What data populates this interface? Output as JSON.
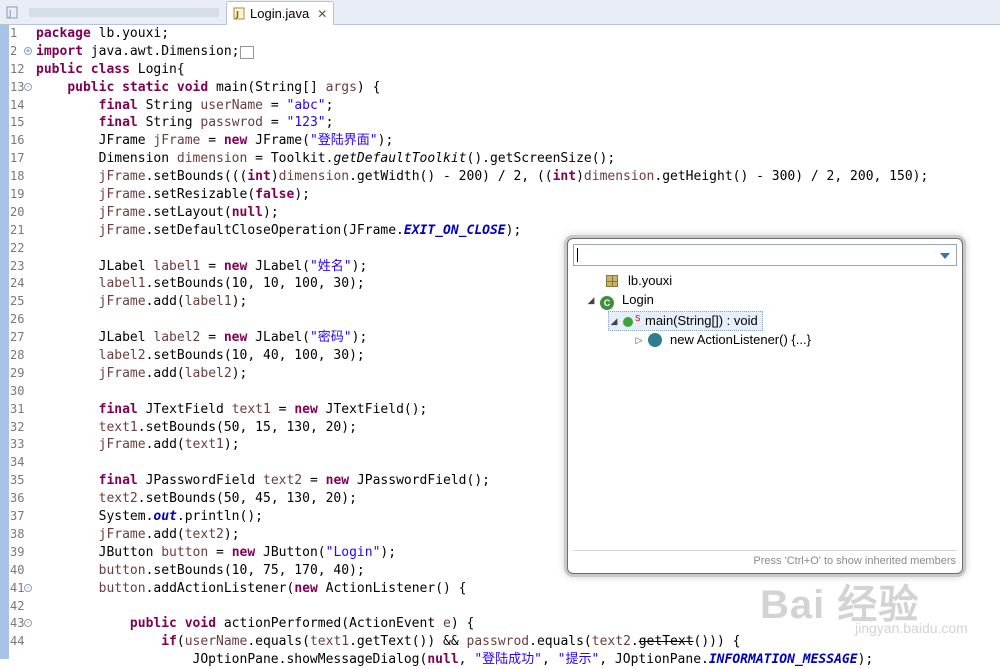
{
  "tabs": [
    {
      "label": "",
      "active": false
    },
    {
      "label": "Login.java",
      "active": true,
      "close": "✕"
    }
  ],
  "code_lines": [
    {
      "n": "1",
      "html": "<span class='kw'>package</span> lb.youxi;"
    },
    {
      "n": "2",
      "fold": "+",
      "html": "<span class='kw'>import</span> java.awt.Dimension;<span style='border:1px solid #999;font-size:10px'>&nbsp;&nbsp;</span>"
    },
    {
      "n": "12",
      "html": "<span class='kw'>public class</span> Login{"
    },
    {
      "n": "13",
      "fold": "-",
      "html": "    <span class='kw'>public static void</span> main(String[] <span class='var'>args</span>) {"
    },
    {
      "n": "14",
      "html": "        <span class='kw'>final</span> String <span class='var'>userName</span> = <span class='str'>\"abc\"</span>;"
    },
    {
      "n": "15",
      "html": "        <span class='kw'>final</span> String <span class='var'>passwrod</span> = <span class='str'>\"123\"</span>;"
    },
    {
      "n": "16",
      "html": "        JFrame <span class='var'>jFrame</span> = <span class='kw'>new</span> JFrame(<span class='str'>\"登陆界面\"</span>);"
    },
    {
      "n": "17",
      "html": "        Dimension <span class='var'>dimension</span> = Toolkit.<span class='ital'>getDefaultToolkit</span>().getScreenSize();"
    },
    {
      "n": "18",
      "html": "        <span class='var'>jFrame</span>.setBounds(((<span class='kw'>int</span>)<span class='var'>dimension</span>.getWidth() - 200) / 2, ((<span class='kw'>int</span>)<span class='var'>dimension</span>.getHeight() - 300) / 2, 200, 150);"
    },
    {
      "n": "19",
      "html": "        <span class='var'>jFrame</span>.setResizable(<span class='kw'>false</span>);"
    },
    {
      "n": "20",
      "html": "        <span class='var'>jFrame</span>.setLayout(<span class='kw'>null</span>);"
    },
    {
      "n": "21",
      "html": "        <span class='var'>jFrame</span>.setDefaultCloseOperation(JFrame.<span class='fldi'>EXIT_ON_CLOSE</span>);"
    },
    {
      "n": "22",
      "html": ""
    },
    {
      "n": "23",
      "html": "        JLabel <span class='var'>label1</span> = <span class='kw'>new</span> JLabel(<span class='str'>\"姓名\"</span>);"
    },
    {
      "n": "24",
      "html": "        <span class='var'>label1</span>.setBounds(10, 10, 100, 30);"
    },
    {
      "n": "25",
      "html": "        <span class='var'>jFrame</span>.add(<span class='var'>label1</span>);"
    },
    {
      "n": "26",
      "html": ""
    },
    {
      "n": "27",
      "html": "        JLabel <span class='var'>label2</span> = <span class='kw'>new</span> JLabel(<span class='str'>\"密码\"</span>);"
    },
    {
      "n": "28",
      "html": "        <span class='var'>label2</span>.setBounds(10, 40, 100, 30);"
    },
    {
      "n": "29",
      "html": "        <span class='var'>jFrame</span>.add(<span class='var'>label2</span>);"
    },
    {
      "n": "30",
      "html": ""
    },
    {
      "n": "31",
      "html": "        <span class='kw'>final</span> JTextField <span class='var'>text1</span> = <span class='kw'>new</span> JTextField();"
    },
    {
      "n": "32",
      "html": "        <span class='var'>text1</span>.setBounds(50, 15, 130, 20);"
    },
    {
      "n": "33",
      "html": "        <span class='var'>jFrame</span>.add(<span class='var'>text1</span>);"
    },
    {
      "n": "34",
      "html": ""
    },
    {
      "n": "35",
      "html": "        <span class='kw'>final</span> JPasswordField <span class='var'>text2</span> = <span class='kw'>new</span> JPasswordField();"
    },
    {
      "n": "36",
      "html": "        <span class='var'>text2</span>.setBounds(50, 45, 130, 20);"
    },
    {
      "n": "37",
      "html": "        System.<span class='fldi'>out</span>.println();"
    },
    {
      "n": "38",
      "html": "        <span class='var'>jFrame</span>.add(<span class='var'>text2</span>);"
    },
    {
      "n": "39",
      "html": "        JButton <span class='var'>button</span> = <span class='kw'>new</span> JButton(<span class='str'>\"Login\"</span>);"
    },
    {
      "n": "40",
      "html": "        <span class='var'>button</span>.setBounds(10, 75, 170, 40);"
    },
    {
      "n": "41",
      "fold": "-",
      "html": "        <span class='var'>button</span>.addActionListener(<span class='kw'>new</span> ActionListener() {"
    },
    {
      "n": "42",
      "html": ""
    },
    {
      "n": "43",
      "fold": "-",
      "html": "            <span class='kw'>public void</span> actionPerformed(ActionEvent <span class='var'>e</span>) {"
    },
    {
      "n": "44",
      "html": "                <span class='kw'>if</span>(<span class='var'>userName</span>.equals(<span class='var'>text1</span>.getText()) &amp;&amp; <span class='var'>passwrod</span>.equals(<span class='var'>text2</span>.<span class='strike'>getText</span>())) {"
    },
    {
      "n": "",
      "html": "                    JOptionPane.showMessageDialog(<span class='kw'>null</span>, <span class='str'>\"登陆成功\"</span>, <span class='str'>\"提示\"</span>, JOptionPane.<span class='fldi'>INFORMATION_MESSAGE</span>);"
    }
  ],
  "outline": {
    "filter_value": "",
    "items": [
      {
        "label": "lb.youxi",
        "kind": "package-icon",
        "twisty": ""
      },
      {
        "label": "Login",
        "kind": "class-icon",
        "twisty": "◢"
      },
      {
        "label": "main(String[]) : void",
        "kind": "method-icon",
        "twisty": "◢",
        "selected": true
      },
      {
        "label": "new ActionListener() {...}",
        "kind": "anonymous-class-icon",
        "twisty": "▷"
      }
    ],
    "hint": "Press 'Ctrl+O' to show inherited members"
  },
  "watermark": {
    "brand": "Bai 经验",
    "url": "jingyan.baidu.com"
  }
}
